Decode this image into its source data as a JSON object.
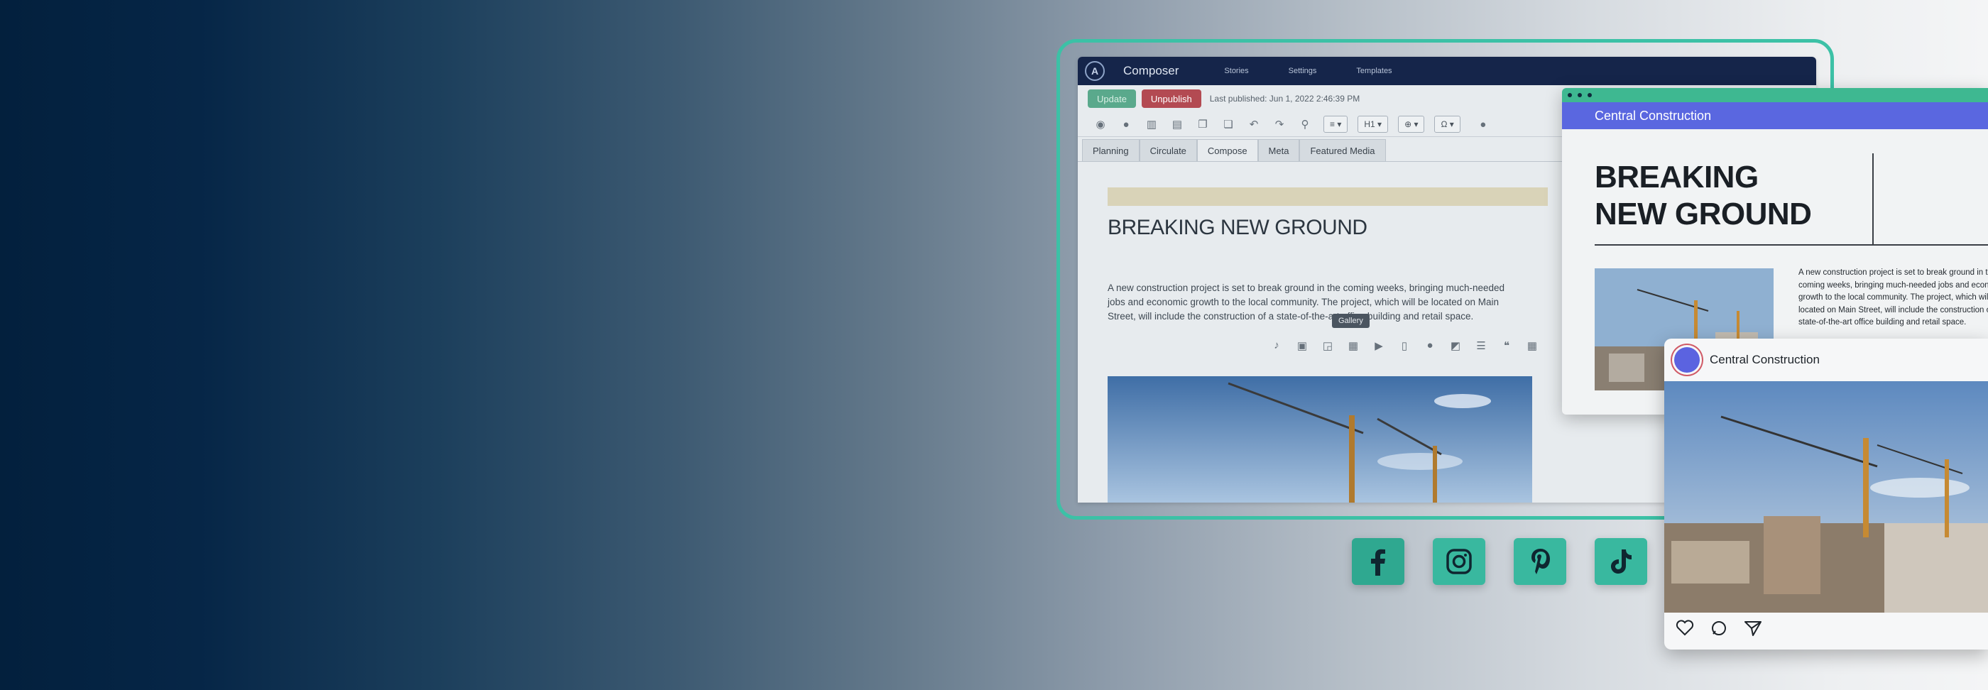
{
  "composer": {
    "app_title": "Composer",
    "logo_letter": "A",
    "nav": [
      "Stories",
      "Settings",
      "Templates"
    ],
    "update_label": "Update",
    "unpublish_label": "Unpublish",
    "last_published": "Last published: Jun 1, 2022 2:46:39 PM",
    "heading_dropdown": "H1 ▾",
    "tabs": [
      "Planning",
      "Circulate",
      "Compose",
      "Meta",
      "Featured Media"
    ],
    "active_tab": "Compose",
    "headline": "BREAKING NEW GROUND",
    "paragraph_lines": [
      "A new construction project is set to break ground in the coming weeks, bringing much-needed",
      "jobs and economic growth to the local community. The project, which will be located on Main",
      "Street, will include the construction of a state-of-the-art office building and retail space."
    ],
    "tooltip": "Gallery"
  },
  "preview": {
    "site_name": "Central Construction",
    "title_line1": "BREAKING",
    "title_line2": "NEW GROUND",
    "body_lines": [
      "A new construction project is set to break ground in the",
      "coming weeks, bringing much-needed jobs and economic",
      "growth to the local community. The project, which will be",
      "located on Main Street, will include the construction of a",
      "state-of-the-art office building and retail space."
    ]
  },
  "social_card": {
    "account_name": "Central Construction",
    "actions": [
      "heart-icon",
      "comment-icon",
      "send-icon"
    ]
  },
  "social_icons": [
    "facebook-icon",
    "instagram-icon",
    "pinterest-icon",
    "tiktok-icon"
  ],
  "colors": {
    "accent_teal": "#3cc1a6",
    "navbar": "#15254a",
    "update_green": "#5aa98c",
    "unpublish_red": "#b34a52",
    "preview_header": "#5a67e0"
  }
}
